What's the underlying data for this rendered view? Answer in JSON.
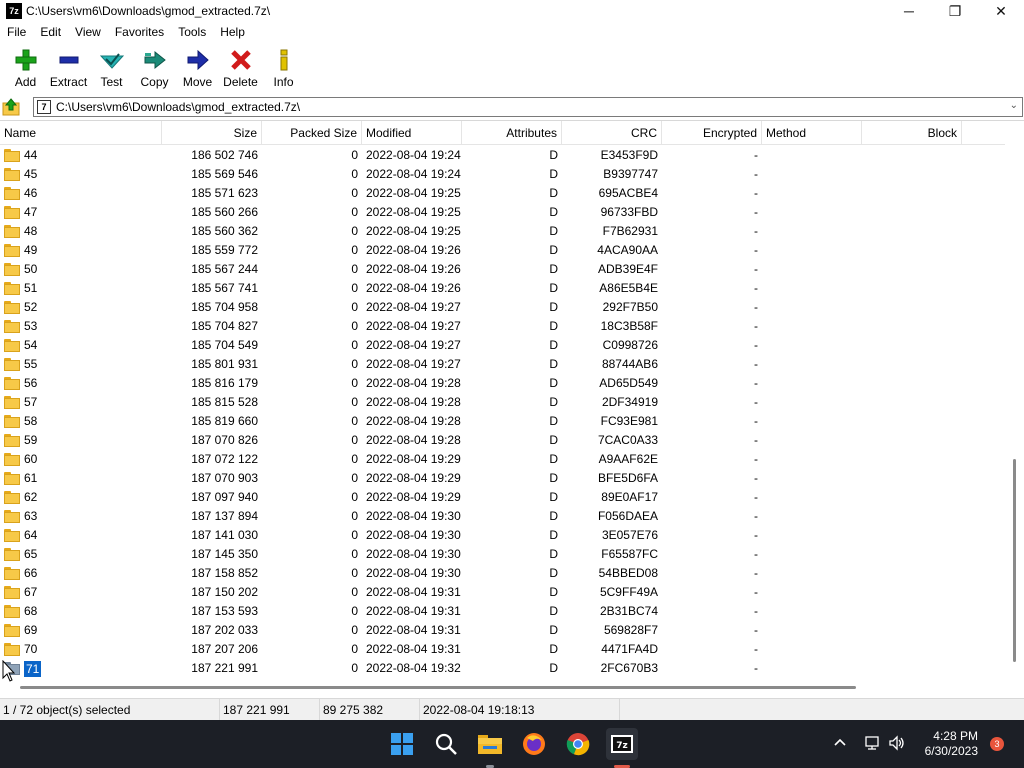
{
  "window": {
    "title": "C:\\Users\\vm6\\Downloads\\gmod_extracted.7z\\",
    "app_icon_text": "7z",
    "controls": {
      "minimize": "─",
      "maximize": "❐",
      "close": "✕"
    }
  },
  "menu": [
    "File",
    "Edit",
    "View",
    "Favorites",
    "Tools",
    "Help"
  ],
  "toolbar": [
    {
      "label": "Add",
      "icon": "plus-icon",
      "color": "#1aa31a"
    },
    {
      "label": "Extract",
      "icon": "minus-icon",
      "color": "#1e2ea8"
    },
    {
      "label": "Test",
      "icon": "check-icon",
      "color": "#27b3b3"
    },
    {
      "label": "Copy",
      "icon": "double-arrow-icon",
      "color": "#1b8a78"
    },
    {
      "label": "Move",
      "icon": "arrow-right-icon",
      "color": "#1e2ea8"
    },
    {
      "label": "Delete",
      "icon": "x-icon",
      "color": "#d11b1b"
    },
    {
      "label": "Info",
      "icon": "info-icon",
      "color": "#c8a800"
    }
  ],
  "address": {
    "path": "C:\\Users\\vm6\\Downloads\\gmod_extracted.7z\\",
    "icon_text": "7"
  },
  "columns": {
    "name": "Name",
    "size": "Size",
    "packed": "Packed Size",
    "modified": "Modified",
    "attributes": "Attributes",
    "crc": "CRC",
    "encrypted": "Encrypted",
    "method": "Method",
    "block": "Block"
  },
  "rows": [
    {
      "name": "44",
      "size": "186 502 746",
      "packed": "0",
      "modified": "2022-08-04 19:24",
      "attr": "D",
      "crc": "E3453F9D",
      "enc": "-"
    },
    {
      "name": "45",
      "size": "185 569 546",
      "packed": "0",
      "modified": "2022-08-04 19:24",
      "attr": "D",
      "crc": "B9397747",
      "enc": "-"
    },
    {
      "name": "46",
      "size": "185 571 623",
      "packed": "0",
      "modified": "2022-08-04 19:25",
      "attr": "D",
      "crc": "695ACBE4",
      "enc": "-"
    },
    {
      "name": "47",
      "size": "185 560 266",
      "packed": "0",
      "modified": "2022-08-04 19:25",
      "attr": "D",
      "crc": "96733FBD",
      "enc": "-"
    },
    {
      "name": "48",
      "size": "185 560 362",
      "packed": "0",
      "modified": "2022-08-04 19:25",
      "attr": "D",
      "crc": "F7B62931",
      "enc": "-"
    },
    {
      "name": "49",
      "size": "185 559 772",
      "packed": "0",
      "modified": "2022-08-04 19:26",
      "attr": "D",
      "crc": "4ACA90AA",
      "enc": "-"
    },
    {
      "name": "50",
      "size": "185 567 244",
      "packed": "0",
      "modified": "2022-08-04 19:26",
      "attr": "D",
      "crc": "ADB39E4F",
      "enc": "-"
    },
    {
      "name": "51",
      "size": "185 567 741",
      "packed": "0",
      "modified": "2022-08-04 19:26",
      "attr": "D",
      "crc": "A86E5B4E",
      "enc": "-"
    },
    {
      "name": "52",
      "size": "185 704 958",
      "packed": "0",
      "modified": "2022-08-04 19:27",
      "attr": "D",
      "crc": "292F7B50",
      "enc": "-"
    },
    {
      "name": "53",
      "size": "185 704 827",
      "packed": "0",
      "modified": "2022-08-04 19:27",
      "attr": "D",
      "crc": "18C3B58F",
      "enc": "-"
    },
    {
      "name": "54",
      "size": "185 704 549",
      "packed": "0",
      "modified": "2022-08-04 19:27",
      "attr": "D",
      "crc": "C0998726",
      "enc": "-"
    },
    {
      "name": "55",
      "size": "185 801 931",
      "packed": "0",
      "modified": "2022-08-04 19:27",
      "attr": "D",
      "crc": "88744AB6",
      "enc": "-"
    },
    {
      "name": "56",
      "size": "185 816 179",
      "packed": "0",
      "modified": "2022-08-04 19:28",
      "attr": "D",
      "crc": "AD65D549",
      "enc": "-"
    },
    {
      "name": "57",
      "size": "185 815 528",
      "packed": "0",
      "modified": "2022-08-04 19:28",
      "attr": "D",
      "crc": "2DF34919",
      "enc": "-"
    },
    {
      "name": "58",
      "size": "185 819 660",
      "packed": "0",
      "modified": "2022-08-04 19:28",
      "attr": "D",
      "crc": "FC93E981",
      "enc": "-"
    },
    {
      "name": "59",
      "size": "187 070 826",
      "packed": "0",
      "modified": "2022-08-04 19:28",
      "attr": "D",
      "crc": "7CAC0A33",
      "enc": "-"
    },
    {
      "name": "60",
      "size": "187 072 122",
      "packed": "0",
      "modified": "2022-08-04 19:29",
      "attr": "D",
      "crc": "A9AAF62E",
      "enc": "-"
    },
    {
      "name": "61",
      "size": "187 070 903",
      "packed": "0",
      "modified": "2022-08-04 19:29",
      "attr": "D",
      "crc": "BFE5D6FA",
      "enc": "-"
    },
    {
      "name": "62",
      "size": "187 097 940",
      "packed": "0",
      "modified": "2022-08-04 19:29",
      "attr": "D",
      "crc": "89E0AF17",
      "enc": "-"
    },
    {
      "name": "63",
      "size": "187 137 894",
      "packed": "0",
      "modified": "2022-08-04 19:30",
      "attr": "D",
      "crc": "F056DAEA",
      "enc": "-"
    },
    {
      "name": "64",
      "size": "187 141 030",
      "packed": "0",
      "modified": "2022-08-04 19:30",
      "attr": "D",
      "crc": "3E057E76",
      "enc": "-"
    },
    {
      "name": "65",
      "size": "187 145 350",
      "packed": "0",
      "modified": "2022-08-04 19:30",
      "attr": "D",
      "crc": "F65587FC",
      "enc": "-"
    },
    {
      "name": "66",
      "size": "187 158 852",
      "packed": "0",
      "modified": "2022-08-04 19:30",
      "attr": "D",
      "crc": "54BBED08",
      "enc": "-"
    },
    {
      "name": "67",
      "size": "187 150 202",
      "packed": "0",
      "modified": "2022-08-04 19:31",
      "attr": "D",
      "crc": "5C9FF49A",
      "enc": "-"
    },
    {
      "name": "68",
      "size": "187 153 593",
      "packed": "0",
      "modified": "2022-08-04 19:31",
      "attr": "D",
      "crc": "2B31BC74",
      "enc": "-"
    },
    {
      "name": "69",
      "size": "187 202 033",
      "packed": "0",
      "modified": "2022-08-04 19:31",
      "attr": "D",
      "crc": "569828F7",
      "enc": "-"
    },
    {
      "name": "70",
      "size": "187 207 206",
      "packed": "0",
      "modified": "2022-08-04 19:31",
      "attr": "D",
      "crc": "4471FA4D",
      "enc": "-"
    },
    {
      "name": "71",
      "size": "187 221 991",
      "packed": "0",
      "modified": "2022-08-04 19:32",
      "attr": "D",
      "crc": "2FC670B3",
      "enc": "-",
      "selected": true
    }
  ],
  "status": {
    "selection": "1 / 72 object(s) selected",
    "size": "187 221 991",
    "packed": "89 275 382",
    "modified": "2022-08-04 19:18:13"
  },
  "taskbar": {
    "time": "4:28 PM",
    "date": "6/30/2023",
    "notifications": "3",
    "apps": [
      "windows-start-icon",
      "search-icon",
      "file-explorer-icon",
      "firefox-icon",
      "chrome-icon",
      "7zip-icon"
    ]
  },
  "colors": {
    "selection": "#0a64c8",
    "folder": "#f7c948",
    "taskbar": "#1c1f26"
  }
}
